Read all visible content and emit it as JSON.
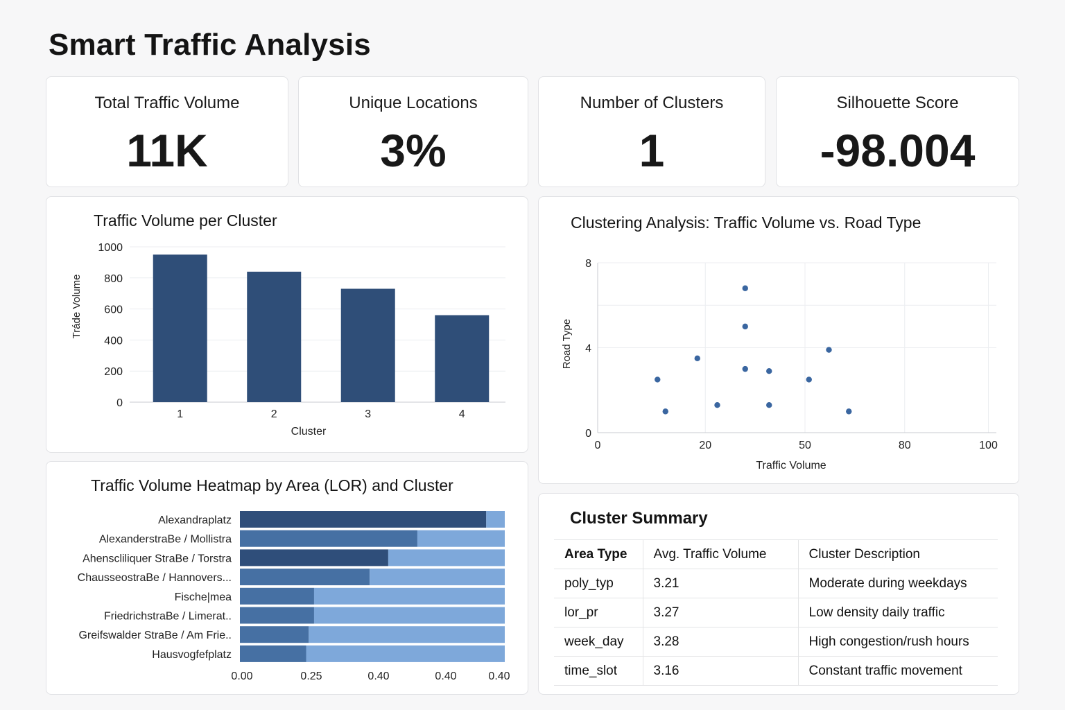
{
  "page": {
    "title": "Smart Traffic Analysis"
  },
  "kpis": [
    {
      "label": "Total Traffic Volume",
      "value": "11K"
    },
    {
      "label": "Unique Locations",
      "value": "3%"
    },
    {
      "label": "Number of Clusters",
      "value": "1"
    },
    {
      "label": "Silhouette Score",
      "value": "-98.004"
    }
  ],
  "bar_chart": {
    "chart_data": {
      "type": "bar",
      "title": "Traffic Volume per Cluster",
      "xlabel": "Cluster",
      "ylabel": "Tráde Volume",
      "categories": [
        "1",
        "2",
        "3",
        "4"
      ],
      "values": [
        950,
        840,
        730,
        560
      ],
      "ylim": [
        0,
        1000
      ],
      "yticks": [
        0,
        200,
        400,
        600,
        800,
        1000
      ],
      "grid": true,
      "bar_color": "#2f4e78"
    }
  },
  "scatter_chart": {
    "chart_data": {
      "type": "scatter",
      "title": "Clustering Analysis: Traffic Volume vs. Road Type",
      "xlabel": "Traffic Volume",
      "ylabel": "Road Type",
      "xticks": [
        "0",
        "20",
        "50",
        "80",
        "100"
      ],
      "yticks": [
        "0",
        "4",
        "8"
      ],
      "xlim": [
        0,
        100
      ],
      "ylim": [
        0,
        8
      ],
      "grid": true,
      "point_color": "#3a66a0",
      "points": [
        {
          "x": 15,
          "y": 2.5
        },
        {
          "x": 17,
          "y": 1.0
        },
        {
          "x": 25,
          "y": 3.5
        },
        {
          "x": 30,
          "y": 1.3
        },
        {
          "x": 37,
          "y": 6.8
        },
        {
          "x": 37,
          "y": 5.0
        },
        {
          "x": 37,
          "y": 3.0
        },
        {
          "x": 43,
          "y": 2.9
        },
        {
          "x": 43,
          "y": 1.3
        },
        {
          "x": 53,
          "y": 2.5
        },
        {
          "x": 58,
          "y": 3.9
        },
        {
          "x": 63,
          "y": 1.0
        }
      ]
    }
  },
  "heatmap_chart": {
    "chart_data": {
      "type": "bar",
      "orientation": "horizontal-stacked",
      "title": "Traffic Volume Heatmap by Area (LOR) and Cluster",
      "categories": [
        "Alexandraplatz",
        "AlexanderstraBe / Mollistra",
        "Ahenscliliquer StraBe / Torstra",
        "ChausseostraBe / Hannovers...",
        "Fische|mea",
        "FriedrichstraBe / Limerat..",
        "Greifswalder StraBe / Am Frie..",
        "Hausvogfefplatz"
      ],
      "series": [
        {
          "values": [
            0.93,
            0.67,
            0.56,
            0.49,
            0.28,
            0.28,
            0.26,
            0.25
          ],
          "color_dark": "#2f4e7a",
          "color_mid": "#4670a3"
        },
        {
          "values": [
            0.07,
            0.33,
            0.44,
            0.51,
            0.72,
            0.72,
            0.74,
            0.75
          ],
          "color": "#7ea8da"
        }
      ],
      "dark_rows": [
        0,
        2
      ],
      "xticks": [
        "0.00",
        "0.25",
        "0.40",
        "0.40",
        "0.40"
      ]
    }
  },
  "summary": {
    "title": "Cluster Summary",
    "headers": [
      "Area Type",
      "Avg. Traffic Volume",
      "Cluster Description"
    ],
    "rows": [
      [
        "poly_typ",
        "3.21",
        "Moderate during weekdays"
      ],
      [
        "lor_pr",
        "3.27",
        "Low density daily traffic"
      ],
      [
        "week_day",
        "3.28",
        "High congestion/rush hours"
      ],
      [
        "time_slot",
        "3.16",
        "Constant traffic movement"
      ]
    ]
  }
}
